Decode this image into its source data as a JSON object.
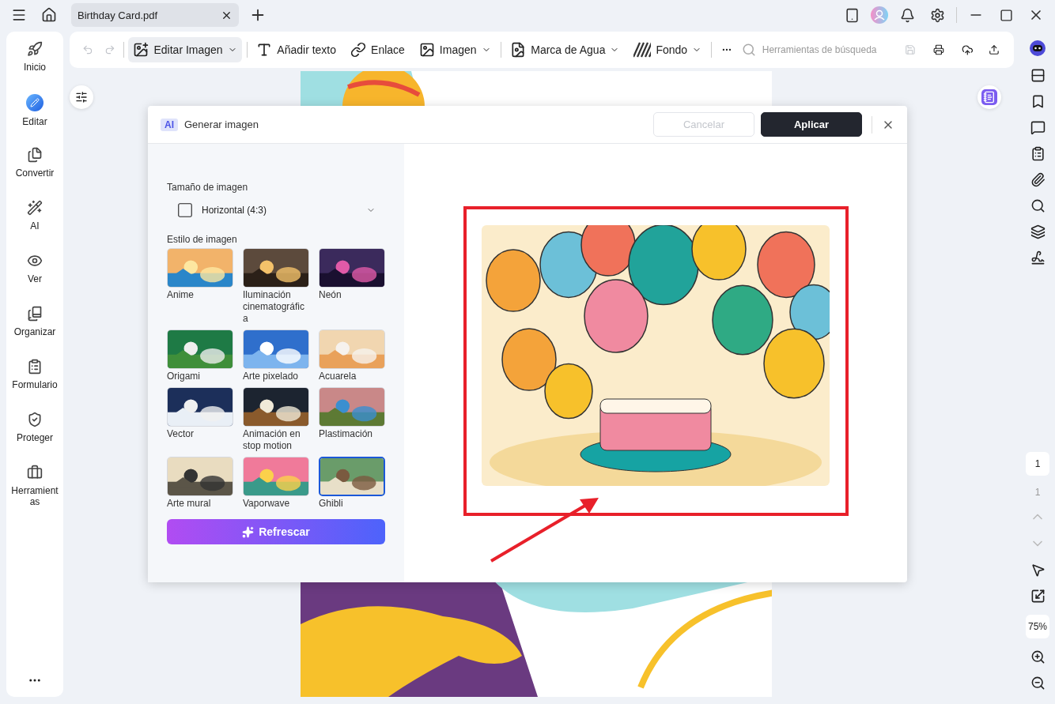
{
  "tab": {
    "title": "Birthday Card.pdf"
  },
  "history": [
    {
      "disabled": true
    },
    {
      "disabled": true
    }
  ],
  "toolbar": [
    {
      "label": "Editar Imagen",
      "selected": true,
      "dropdown": true
    },
    {
      "label": "Añadir texto",
      "selected": false,
      "dropdown": false
    },
    {
      "label": "Enlace",
      "selected": false,
      "dropdown": false
    },
    {
      "label": "Imagen",
      "selected": false,
      "dropdown": true
    },
    {
      "label": "Marca de Agua",
      "selected": false,
      "dropdown": true
    },
    {
      "label": "Fondo",
      "selected": false,
      "dropdown": true
    }
  ],
  "search": {
    "placeholder": "Herramientas de búsqueda"
  },
  "save_disabled": true,
  "sidebar": [
    {
      "label": "Inicio",
      "selected": false
    },
    {
      "label": "Editar",
      "selected": true
    },
    {
      "label": "Convertir",
      "selected": false
    },
    {
      "label": "AI",
      "selected": false
    },
    {
      "label": "Ver",
      "selected": false
    },
    {
      "label": "Organizar",
      "selected": false
    },
    {
      "label": "Formulario",
      "selected": false
    },
    {
      "label": "Proteger",
      "selected": false
    },
    {
      "label": "Herramientas",
      "selected": false
    }
  ],
  "dialog": {
    "badge": "AI",
    "title": "Generar imagen",
    "cancel": {
      "label": "Cancelar",
      "disabled": true
    },
    "apply": {
      "label": "Aplicar"
    },
    "size_label": "Tamaño de imagen",
    "size_value": "Horizontal (4:3)",
    "style_label": "Estilo de imagen",
    "styles": [
      {
        "label": "Anime",
        "selected": false
      },
      {
        "label": "Iluminación cinematográfica",
        "selected": false
      },
      {
        "label": "Neón",
        "selected": false
      },
      {
        "label": "Origami",
        "selected": false
      },
      {
        "label": "Arte pixelado",
        "selected": false
      },
      {
        "label": "Acuarela",
        "selected": false
      },
      {
        "label": "Vector",
        "selected": false
      },
      {
        "label": "Animación en stop motion",
        "selected": false
      },
      {
        "label": "Plastimación",
        "selected": false
      },
      {
        "label": "Arte mural",
        "selected": false
      },
      {
        "label": "Vaporwave",
        "selected": false
      },
      {
        "label": "Ghibli",
        "selected": true
      }
    ],
    "refresh": "Refrescar"
  },
  "pager": {
    "page": "1",
    "total": "1",
    "zoom": "75%"
  }
}
